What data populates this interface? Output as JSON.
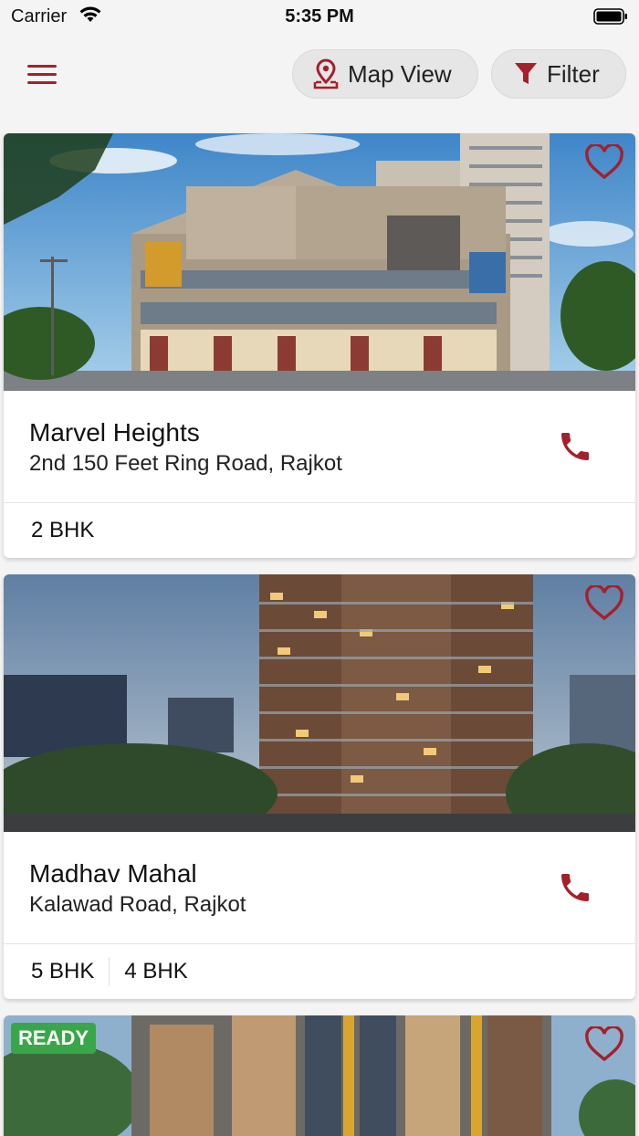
{
  "status_bar": {
    "carrier": "Carrier",
    "time": "5:35 PM"
  },
  "header": {
    "menu_icon": "hamburger-menu-icon",
    "map_view_label": "Map View",
    "map_view_icon": "map-pin-icon",
    "filter_label": "Filter",
    "filter_icon": "funnel-icon"
  },
  "colors": {
    "accent": "#a3212b",
    "ready": "#3aa64a",
    "pill_bg": "#e6e6e6"
  },
  "listings": [
    {
      "name": "Marvel Heights",
      "address": "2nd 150 Feet Ring Road, Rajkot",
      "configs": [
        "2 BHK"
      ],
      "image_semantic": "commercial building with residential tower"
    },
    {
      "name": "Madhav Mahal",
      "address": "Kalawad Road, Rajkot",
      "configs": [
        "5 BHK",
        "4 BHK"
      ],
      "image_semantic": "residential high-rise tower at dusk"
    },
    {
      "badge": "READY",
      "image_semantic": "residential building facade"
    }
  ]
}
